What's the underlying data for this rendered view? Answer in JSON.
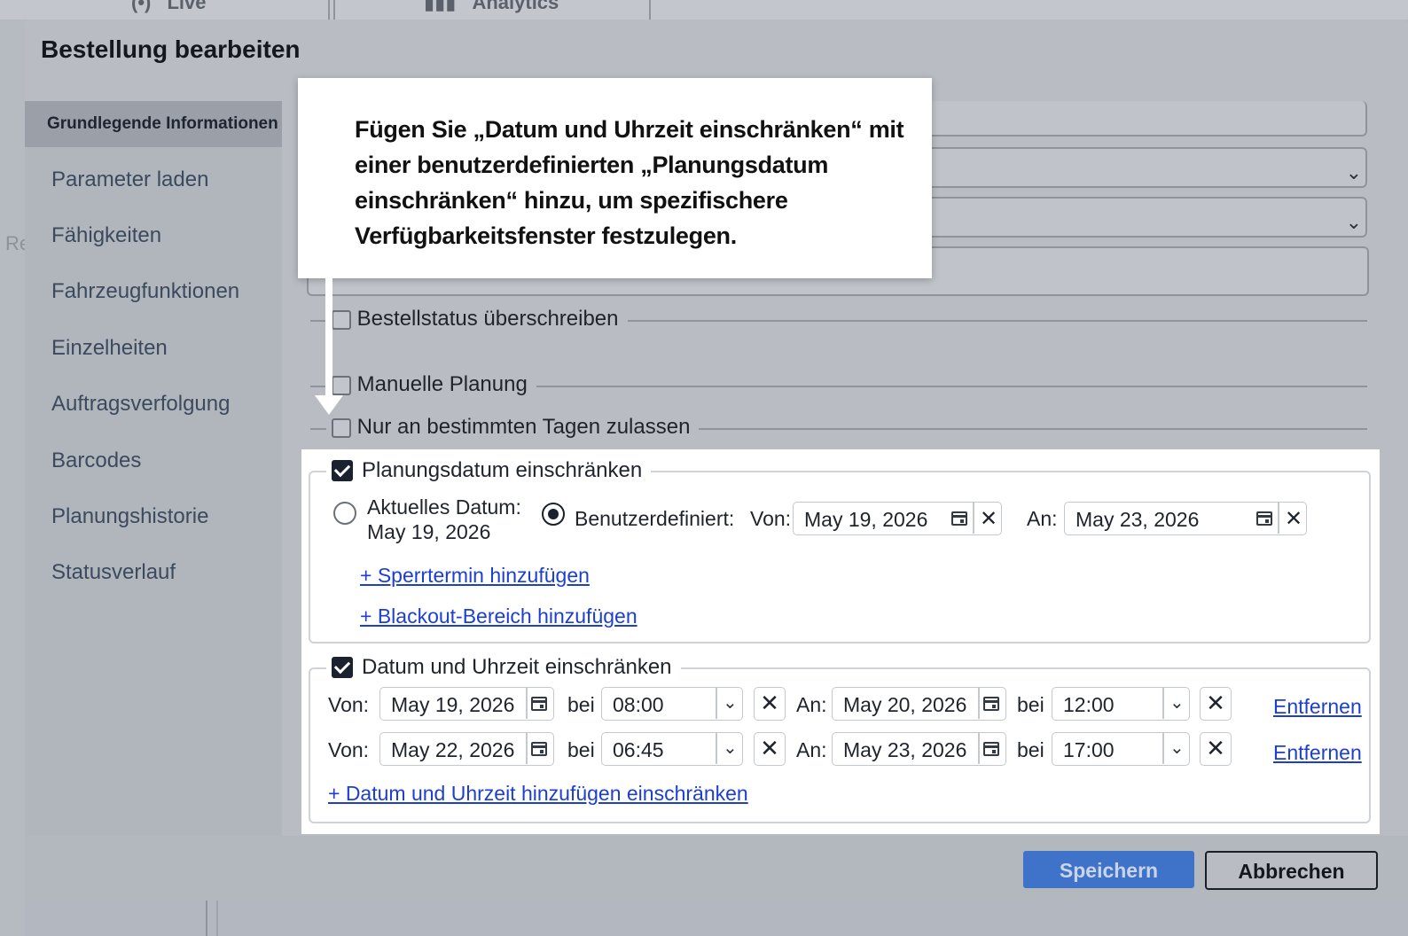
{
  "background": {
    "tabs": [
      {
        "label": "Live",
        "icon": "live-icon"
      },
      {
        "label": "Analytics",
        "icon": "bar-chart-icon"
      }
    ],
    "left_letter": "Re"
  },
  "modal": {
    "title": "Bestellung bearbeiten",
    "nav": [
      {
        "label": "Grundlegende Informationen",
        "active": true
      },
      {
        "label": "Parameter laden"
      },
      {
        "label": "Fähigkeiten"
      },
      {
        "label": "Fahrzeugfunktionen"
      },
      {
        "label": "Einzelheiten"
      },
      {
        "label": "Auftragsverfolgung"
      },
      {
        "label": "Barcodes"
      },
      {
        "label": "Planungshistorie"
      },
      {
        "label": "Statusverlauf"
      }
    ],
    "options": {
      "override_status": "Bestellstatus überschreiben",
      "manual_planning": "Manuelle Planung",
      "specific_days": "Nur an bestimmten Tagen zulassen"
    }
  },
  "tooltip": {
    "text": "Fügen Sie „Datum und Uhrzeit einschränken“ mit einer benutzerdefinierten „Planungsdatum einschränken“ hinzu, um spezifischere Verfügbarkeitsfenster festzulegen."
  },
  "planning_date": {
    "legend": "Planungsdatum einschränken",
    "current_label": "Aktuelles Datum:",
    "current_value": "May 19, 2026",
    "custom_label": "Benutzerdefiniert:",
    "from_label": "Von:",
    "from_value": "May 19, 2026",
    "to_label": "An:",
    "to_value": "May 23, 2026",
    "add_blackout_date": "+ Sperrtermin hinzufügen",
    "add_blackout_range": "+ Blackout-Bereich hinzufügen"
  },
  "date_time": {
    "legend": "Datum und Uhrzeit einschränken",
    "from_label": "Von:",
    "at_label": "bei",
    "to_label": "An:",
    "remove_label": "Entfernen",
    "rows": [
      {
        "from_date": "May 19, 2026",
        "from_time": "08:00",
        "to_date": "May 20, 2026",
        "to_time": "12:00"
      },
      {
        "from_date": "May 22, 2026",
        "from_time": "06:45",
        "to_date": "May 23, 2026",
        "to_time": "17:00"
      }
    ],
    "add_link": "+ Datum und Uhrzeit hinzufügen einschränken"
  },
  "footer": {
    "save": "Speichern",
    "cancel": "Abbrechen"
  }
}
